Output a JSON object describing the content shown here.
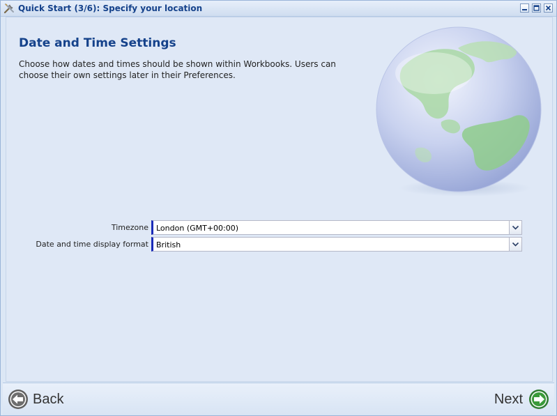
{
  "window": {
    "title": "Quick Start (3/6): Specify your location"
  },
  "page": {
    "heading": "Date and Time Settings",
    "description": "Choose how dates and times should be shown within Workbooks. Users can choose their own settings later in their Preferences."
  },
  "form": {
    "timezone": {
      "label": "Timezone",
      "value": "London (GMT+00:00)"
    },
    "date_format": {
      "label": "Date and time display format",
      "value": "British"
    }
  },
  "footer": {
    "back_label": "Back",
    "next_label": "Next"
  },
  "colors": {
    "title_text": "#15428b",
    "required_marker": "#1a2bb8",
    "next_icon": "#3a9a3a",
    "back_icon": "#777777"
  }
}
